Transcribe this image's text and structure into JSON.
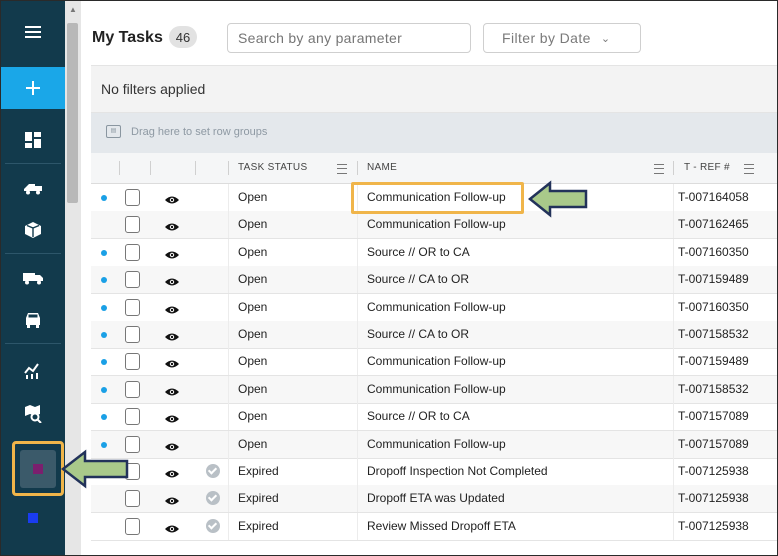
{
  "header": {
    "title": "My Tasks",
    "count": "46",
    "search_placeholder": "Search by any parameter",
    "filter_label": "Filter by Date",
    "filter_chevron": "⌄"
  },
  "filters_status": "No filters applied",
  "group_bar": {
    "icon": "row-group-icon",
    "hint": "Drag here to set row groups"
  },
  "columns": {
    "status": "TASK STATUS",
    "name": "NAME",
    "ref": "T - REF #"
  },
  "rows": [
    {
      "dot": true,
      "status_check": false,
      "status": "Open",
      "name": "Communication Follow-up",
      "ref": "T-007164058"
    },
    {
      "dot": false,
      "status_check": false,
      "status": "Open",
      "name": "Communication Follow-up",
      "ref": "T-007162465"
    },
    {
      "dot": true,
      "status_check": false,
      "status": "Open",
      "name": "Source // OR to CA",
      "ref": "T-007160350"
    },
    {
      "dot": true,
      "status_check": false,
      "status": "Open",
      "name": "Source // CA to OR",
      "ref": "T-007159489"
    },
    {
      "dot": true,
      "status_check": false,
      "status": "Open",
      "name": "Communication Follow-up",
      "ref": "T-007160350"
    },
    {
      "dot": true,
      "status_check": false,
      "status": "Open",
      "name": "Source // CA to OR",
      "ref": "T-007158532"
    },
    {
      "dot": true,
      "status_check": false,
      "status": "Open",
      "name": "Communication Follow-up",
      "ref": "T-007159489"
    },
    {
      "dot": true,
      "status_check": false,
      "status": "Open",
      "name": "Communication Follow-up",
      "ref": "T-007158532"
    },
    {
      "dot": true,
      "status_check": false,
      "status": "Open",
      "name": "Source // OR to CA",
      "ref": "T-007157089"
    },
    {
      "dot": true,
      "status_check": false,
      "status": "Open",
      "name": "Communication Follow-up",
      "ref": "T-007157089"
    },
    {
      "dot": false,
      "status_check": true,
      "status": "Expired",
      "name": "Dropoff Inspection Not Completed",
      "ref": "T-007125938"
    },
    {
      "dot": false,
      "status_check": true,
      "status": "Expired",
      "name": "Dropoff ETA was Updated",
      "ref": "T-007125938"
    },
    {
      "dot": false,
      "status_check": true,
      "status": "Expired",
      "name": "Review Missed Dropoff ETA",
      "ref": "T-007125938"
    }
  ],
  "sidebar": {
    "items": [
      {
        "icon": "hamburger-menu-icon"
      },
      {
        "icon": "plus-icon"
      },
      {
        "icon": "dashboard-icon"
      },
      {
        "icon": "tow-truck-icon"
      },
      {
        "icon": "package-icon"
      },
      {
        "icon": "truck-icon"
      },
      {
        "icon": "car-front-icon"
      },
      {
        "icon": "chart-icon"
      },
      {
        "icon": "map-search-icon"
      },
      {
        "icon": "purple-square-icon",
        "color": "#7b1f6e"
      },
      {
        "icon": "blue-square-icon",
        "color": "#1a3cf0"
      }
    ]
  },
  "colors": {
    "sidebar_bg": "#123a4c",
    "accent_blue": "#1aa7e8",
    "highlight": "#f0b54a",
    "arrow_fill": "#a9c98a",
    "arrow_stroke": "#22325a"
  }
}
